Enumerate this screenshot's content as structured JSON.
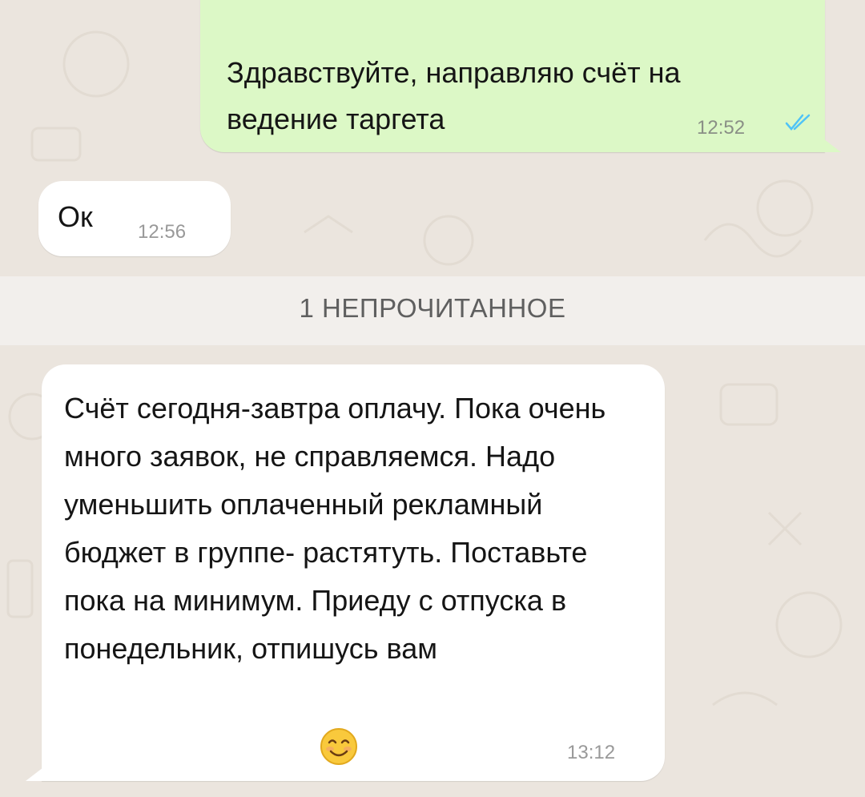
{
  "messages": [
    {
      "direction": "outgoing",
      "text": "Здравствуйте, направляю счёт на ведение таргета",
      "time": "12:52",
      "status_icon": "double-check-read-icon"
    },
    {
      "direction": "incoming",
      "text": "Ок",
      "time": "12:56"
    },
    {
      "direction": "incoming",
      "text": "Счёт сегодня-завтра оплачу. Пока очень много заявок, не справляемся. Надо уменьшить оплаченный рекламный бюджет в группе- растятуть. Поставьте пока на минимум. Приеду с отпуска в понедельник, отпишусь вам",
      "time": "13:12",
      "emoji": "smiling-face-emoji"
    }
  ],
  "unread_divider": "1 НЕПРОЧИТАННОЕ",
  "colors": {
    "chat_background": "#ebe5de",
    "outgoing_bubble": "#dcf8c6",
    "incoming_bubble": "#ffffff",
    "read_ticks": "#4fc3f7",
    "timestamp": "#999999"
  }
}
